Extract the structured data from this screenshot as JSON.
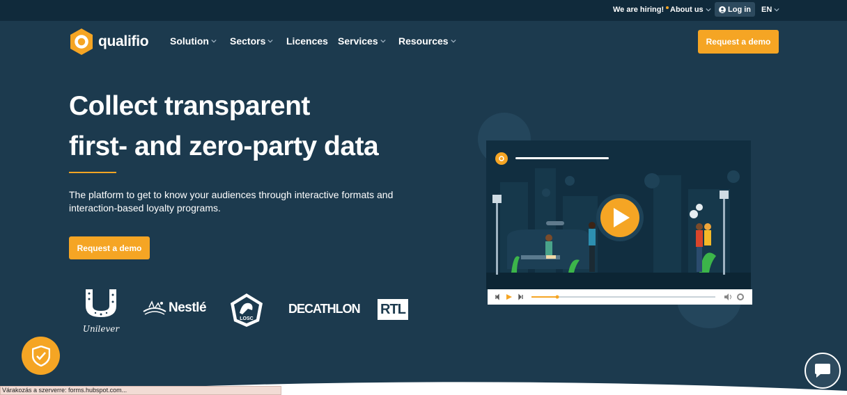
{
  "topbar": {
    "hiring": "We are hiring!",
    "about": "About us",
    "login": "Log in",
    "lang": "EN"
  },
  "header": {
    "logo_text": "qualifio",
    "nav": [
      {
        "label": "Solution"
      },
      {
        "label": "Sectors"
      },
      {
        "label": "Licences"
      },
      {
        "label": "Services"
      },
      {
        "label": "Resources"
      }
    ],
    "cta": "Request a demo"
  },
  "hero": {
    "title_line1": "Collect transparent",
    "title_line2": "first- and zero-party data",
    "subtitle": "The platform to get to know your audiences through interactive formats and interaction-based loyalty programs.",
    "cta": "Request a demo"
  },
  "brands": [
    {
      "name": "Unilever"
    },
    {
      "name": "Nestlé"
    },
    {
      "name": "LOSC"
    },
    {
      "name": "DECATHLON"
    },
    {
      "name": "RTL"
    }
  ],
  "video": {
    "progress": 0.14
  },
  "status": {
    "text": "Várakozás a szerverre: forms.hubspot.com..."
  },
  "colors": {
    "background": "#1c3a4e",
    "topbar": "#102a3b",
    "accent": "#f5a524"
  },
  "icons": [
    "user-icon",
    "chevron-down-icon",
    "play-icon",
    "shield-check-icon",
    "chat-icon",
    "volume-icon",
    "settings-icon"
  ]
}
